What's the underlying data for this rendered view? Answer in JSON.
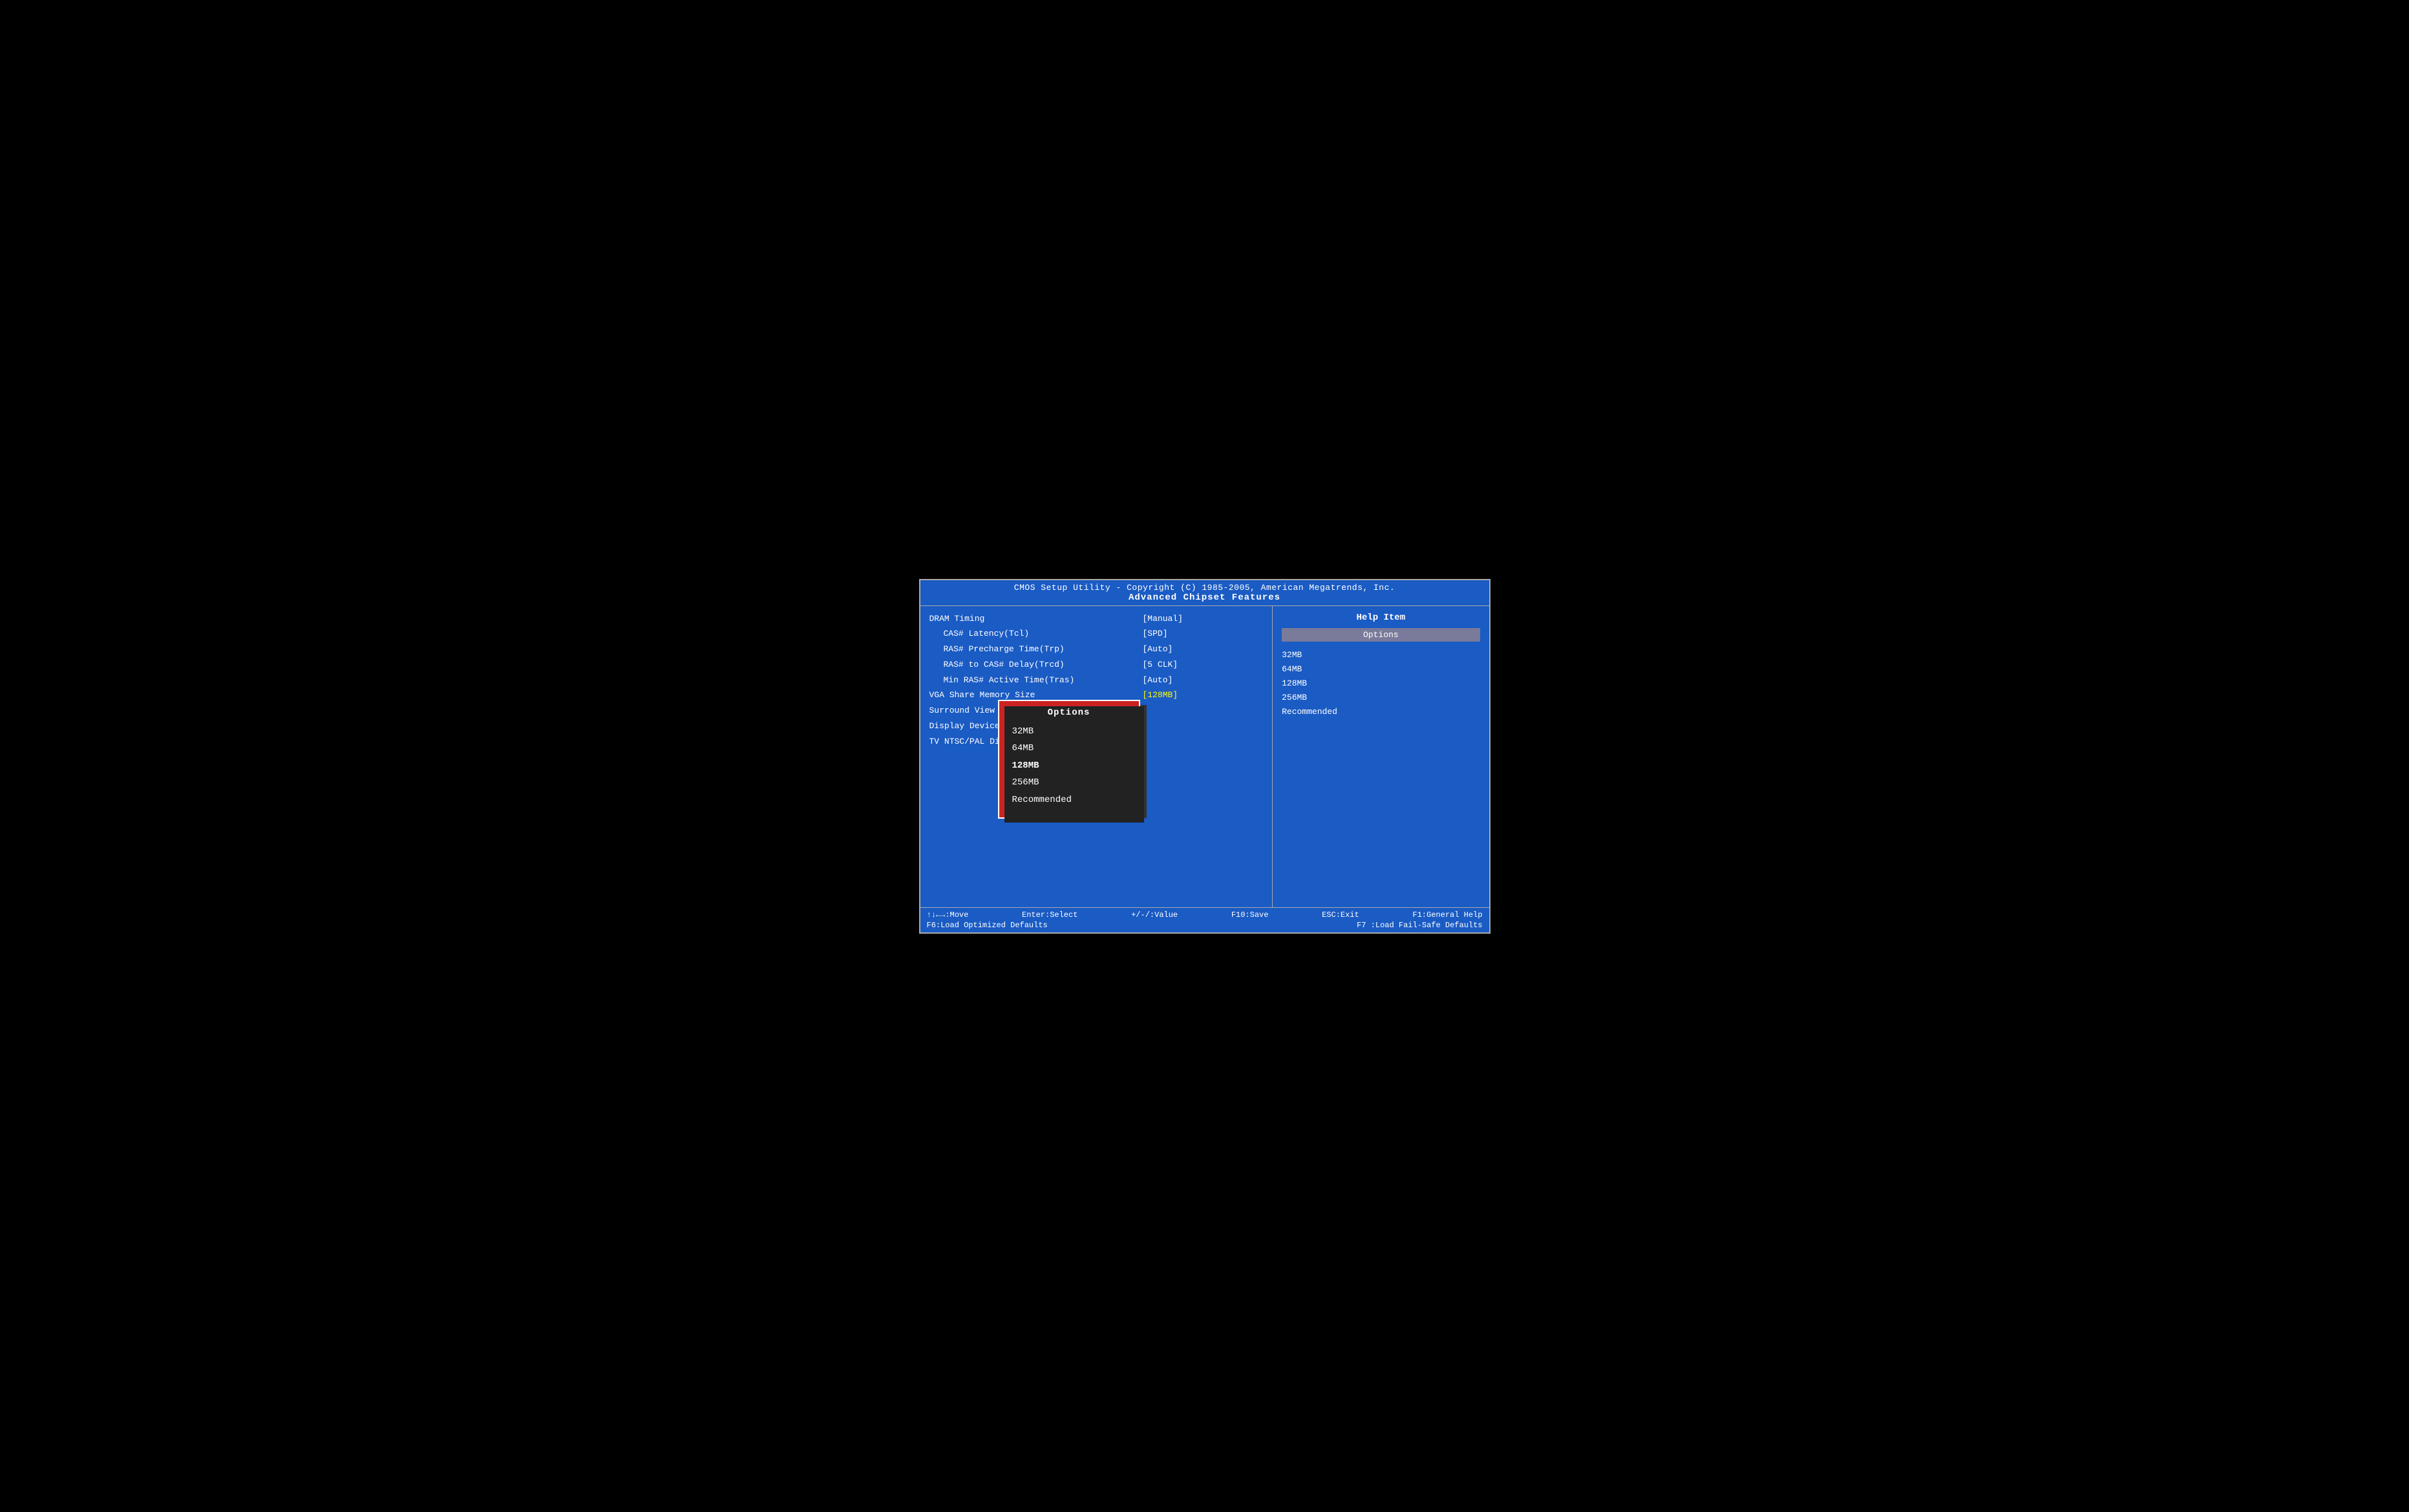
{
  "header": {
    "line1": "CMOS Setup Utility - Copyright (C) 1985-2005, American Megatrends, Inc.",
    "line2": "Advanced Chipset Features"
  },
  "menu": {
    "items": [
      {
        "label": "DRAM Timing",
        "value": "[Manual]",
        "indented": false
      },
      {
        "label": "CAS# Latency(Tcl)",
        "value": "[SPD]",
        "indented": true
      },
      {
        "label": "RAS# Precharge Time(Trp)",
        "value": "[Auto]",
        "indented": true
      },
      {
        "label": "RAS# to CAS# Delay(Trcd)",
        "value": "[5 CLK]",
        "indented": true
      },
      {
        "label": "Min RAS# Active Time(Tras)",
        "value": "[Auto]",
        "indented": true
      },
      {
        "label": "VGA Share Memory Size",
        "value": "[128MB]",
        "indented": false,
        "selected": true
      },
      {
        "label": "Surround View",
        "value": "",
        "indented": false
      },
      {
        "label": "Display Device Select",
        "value": "",
        "indented": false
      },
      {
        "label": "TV NTSC/PAL Display Select",
        "value": "",
        "indented": false
      }
    ]
  },
  "dropdown": {
    "title": "Options",
    "items": [
      {
        "label": "32MB",
        "active": false
      },
      {
        "label": "64MB",
        "active": false
      },
      {
        "label": "128MB",
        "active": true
      },
      {
        "label": "256MB",
        "active": false
      },
      {
        "label": "Recommended",
        "active": false
      }
    ]
  },
  "help": {
    "title": "Help Item",
    "options_label": "Options",
    "options_list": [
      "32MB",
      "64MB",
      "128MB",
      "256MB",
      "Recommended"
    ]
  },
  "footer": {
    "row1": [
      "↑↓←→:Move",
      "Enter:Select",
      "+/-/:Value",
      "F10:Save",
      "ESC:Exit",
      "F1:General Help"
    ],
    "row2": [
      "F6:Load Optimized Defaults",
      "F7 :Load Fail-Safe Defaults"
    ]
  }
}
